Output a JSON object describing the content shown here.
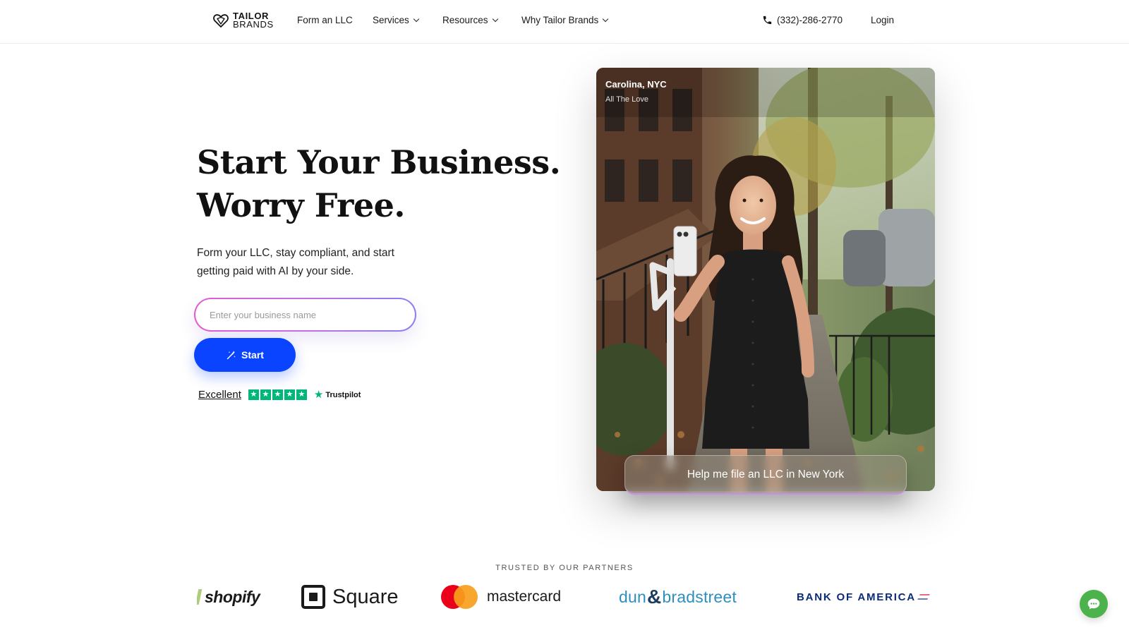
{
  "nav": {
    "logo": {
      "line1": "TAILOR",
      "line2": "BRANDS"
    },
    "items": [
      {
        "label": "Form an LLC",
        "has_dropdown": false
      },
      {
        "label": "Services",
        "has_dropdown": true
      },
      {
        "label": "Resources",
        "has_dropdown": true
      },
      {
        "label": "Why Tailor Brands",
        "has_dropdown": true
      }
    ],
    "phone": "(332)-286-2770",
    "phone_icon": "phone-icon",
    "login": "Login"
  },
  "hero": {
    "headline_line1": "Start Your Business.",
    "headline_line2": "Worry Free.",
    "subtext": "Form your LLC, stay compliant, and start getting paid with AI by your side.",
    "input": {
      "placeholder": "Enter your business name",
      "value": ""
    },
    "start_button": {
      "label": "Start",
      "icon": "magic-wand-icon",
      "color": "#0b44ff"
    },
    "rating": {
      "label": "Excellent",
      "stars": 5,
      "brand": "Trustpilot",
      "star_color": "#00b67a"
    }
  },
  "testimonial": {
    "name": "Carolina, NYC",
    "business": "All The Love",
    "prompt": "Help me file an LLC in New York"
  },
  "partners": {
    "label": "TRUSTED BY OUR PARTNERS",
    "logos": [
      {
        "name": "shopify",
        "text": "shopify"
      },
      {
        "name": "square",
        "text": "Square"
      },
      {
        "name": "mastercard",
        "text": "mastercard"
      },
      {
        "name": "dun-bradstreet",
        "text_a": "dun",
        "text_amp": "&",
        "text_b": "bradstreet"
      },
      {
        "name": "bank-of-america",
        "text": "BANK OF AMERICA"
      }
    ]
  },
  "chat": {
    "icon": "chat-bubble-icon",
    "color": "#4cb34c"
  }
}
